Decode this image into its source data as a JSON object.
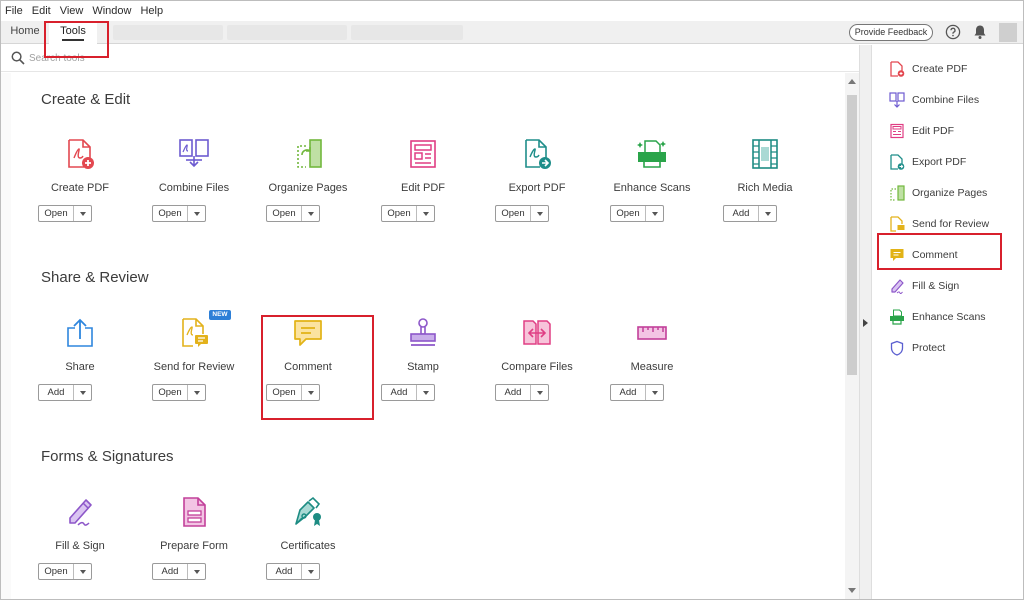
{
  "menubar": {
    "items": [
      "File",
      "Edit",
      "View",
      "Window",
      "Help"
    ]
  },
  "tabs": {
    "home": "Home",
    "tools": "Tools"
  },
  "header": {
    "feedback": "Provide Feedback"
  },
  "search": {
    "placeholder": "Search tools"
  },
  "sections": [
    {
      "title": "Create & Edit",
      "tools": [
        {
          "name": "Create PDF",
          "action": "Open",
          "icon": "create-pdf-icon",
          "color": "#e34850"
        },
        {
          "name": "Combine Files",
          "action": "Open",
          "icon": "combine-files-icon",
          "color": "#6d5bd0"
        },
        {
          "name": "Organize Pages",
          "action": "Open",
          "icon": "organize-pages-icon",
          "color": "#72b73d"
        },
        {
          "name": "Edit PDF",
          "action": "Open",
          "icon": "edit-pdf-icon",
          "color": "#e03e84"
        },
        {
          "name": "Export PDF",
          "action": "Open",
          "icon": "export-pdf-icon",
          "color": "#1f8e8a"
        },
        {
          "name": "Enhance Scans",
          "action": "Open",
          "icon": "enhance-scans-icon",
          "color": "#2aa44a"
        },
        {
          "name": "Rich Media",
          "action": "Add",
          "icon": "rich-media-icon",
          "color": "#1d8c83"
        }
      ]
    },
    {
      "title": "Share & Review",
      "tools": [
        {
          "name": "Share",
          "action": "Add",
          "icon": "share-icon",
          "color": "#2e86de"
        },
        {
          "name": "Send for Review",
          "action": "Open",
          "icon": "send-for-review-icon",
          "color": "#e3b21b",
          "badge": "NEW"
        },
        {
          "name": "Comment",
          "action": "Open",
          "icon": "comment-icon",
          "color": "#e2b316"
        },
        {
          "name": "Stamp",
          "action": "Add",
          "icon": "stamp-icon",
          "color": "#8d57c9"
        },
        {
          "name": "Compare Files",
          "action": "Add",
          "icon": "compare-files-icon",
          "color": "#e03e84"
        },
        {
          "name": "Measure",
          "action": "Add",
          "icon": "measure-icon",
          "color": "#c2409a"
        }
      ]
    },
    {
      "title": "Forms & Signatures",
      "tools": [
        {
          "name": "Fill & Sign",
          "action": "Open",
          "icon": "fill-sign-icon",
          "color": "#8d57c9"
        },
        {
          "name": "Prepare Form",
          "action": "Add",
          "icon": "prepare-form-icon",
          "color": "#c2409a"
        },
        {
          "name": "Certificates",
          "action": "Add",
          "icon": "certificates-icon",
          "color": "#1d8c83"
        }
      ]
    }
  ],
  "right_panel": {
    "items": [
      {
        "label": "Create PDF",
        "icon": "create-pdf-icon",
        "color": "#e34850"
      },
      {
        "label": "Combine Files",
        "icon": "combine-files-icon",
        "color": "#6d5bd0"
      },
      {
        "label": "Edit PDF",
        "icon": "edit-pdf-icon",
        "color": "#e03e84"
      },
      {
        "label": "Export PDF",
        "icon": "export-pdf-icon",
        "color": "#1f8e8a"
      },
      {
        "label": "Organize Pages",
        "icon": "organize-pages-icon",
        "color": "#72b73d"
      },
      {
        "label": "Send for Review",
        "icon": "send-for-review-icon",
        "color": "#e3b21b"
      },
      {
        "label": "Comment",
        "icon": "comment-icon",
        "color": "#e2b316"
      },
      {
        "label": "Fill & Sign",
        "icon": "fill-sign-icon",
        "color": "#8d57c9"
      },
      {
        "label": "Enhance Scans",
        "icon": "enhance-scans-icon",
        "color": "#2aa44a"
      },
      {
        "label": "Protect",
        "icon": "protect-icon",
        "color": "#5b5fd0"
      }
    ]
  },
  "colors": {
    "highlight": "#d8202c",
    "accent": "#2d7fd7"
  }
}
